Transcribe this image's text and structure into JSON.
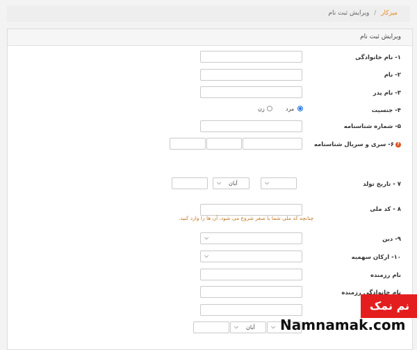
{
  "breadcrumb": {
    "home": "میزکار",
    "separator": "/",
    "current": "ویرایش ثبت نام"
  },
  "panel": {
    "title": "ویرایش ثبت نام"
  },
  "fields": {
    "lastname": {
      "label": "۱- نام خانوادگی",
      "value": ""
    },
    "firstname": {
      "label": "۲- نام",
      "value": ""
    },
    "father": {
      "label": "۳- نام پدر",
      "value": ""
    },
    "gender": {
      "label": "۴- جنسیت",
      "options": [
        "مرد",
        "زن"
      ],
      "selected": "مرد"
    },
    "id_number": {
      "label": "۵- شماره شناسنامه",
      "value": ""
    },
    "id_serial": {
      "label": "۶- سری و سریال شناسنامه",
      "help_icon": "question-icon"
    },
    "birth_date": {
      "label": "۷ - تاریخ تولد",
      "month": "آبان",
      "year": "",
      "day": ""
    },
    "national_code": {
      "label": "۸ - کد ملی",
      "hint": "چنانچه کد ملی شما با صفر شروع می شود، آن ها را وارد کنید."
    },
    "religion": {
      "label": "۹- دین",
      "value": ""
    },
    "shares": {
      "label": "۱۰- ارکان سهمیه",
      "value": ""
    },
    "fighter_name": {
      "label": "نام رزمنده",
      "value": ""
    },
    "fighter_lastname": {
      "label": "نام خانوادگی رزمنده",
      "value": ""
    },
    "extra_date": {
      "month": "آبان"
    }
  },
  "watermark": {
    "fa": "نم نمک",
    "en": "Namnamak.com"
  }
}
